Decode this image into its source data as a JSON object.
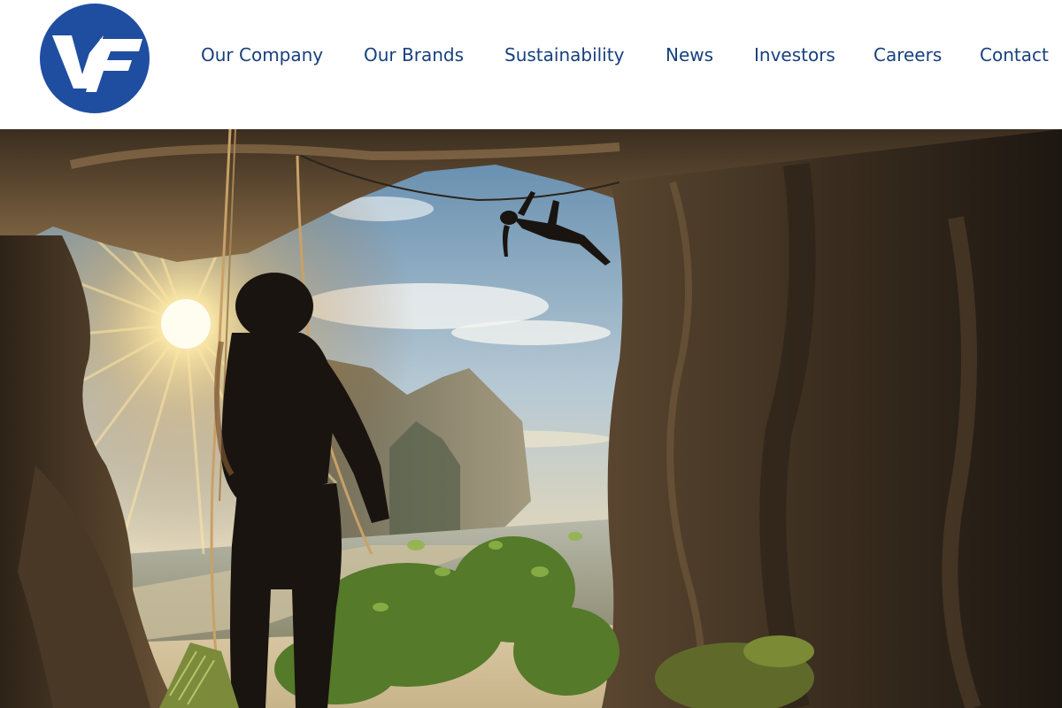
{
  "brand": {
    "logo_text": "VF",
    "logo_color": "#1f4ea1",
    "nav_color": "#17407e"
  },
  "nav": {
    "items": [
      {
        "label": "Our Company"
      },
      {
        "label": "Our Brands"
      },
      {
        "label": "Sustainability"
      },
      {
        "label": "News"
      },
      {
        "label": "Investors"
      },
      {
        "label": "Careers"
      },
      {
        "label": "Contact"
      }
    ]
  }
}
